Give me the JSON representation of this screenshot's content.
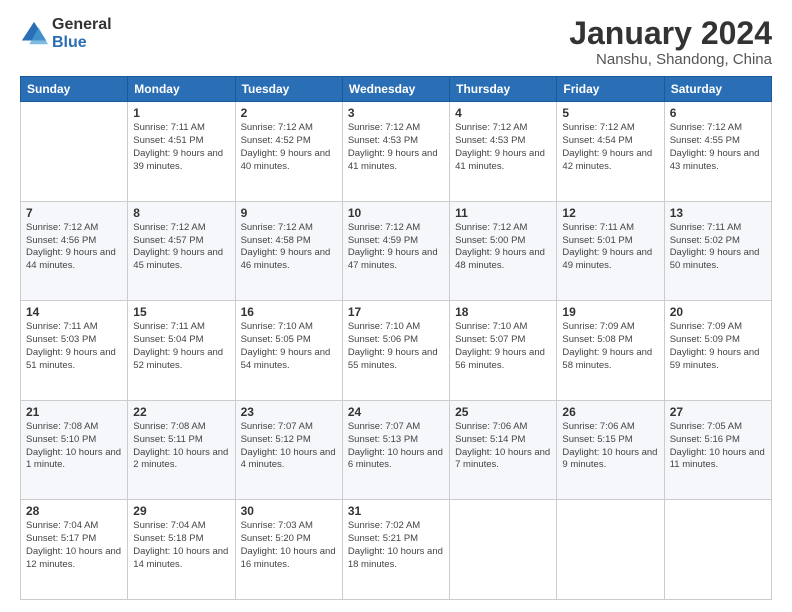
{
  "logo": {
    "general": "General",
    "blue": "Blue"
  },
  "title": "January 2024",
  "subtitle": "Nanshu, Shandong, China",
  "days_of_week": [
    "Sunday",
    "Monday",
    "Tuesday",
    "Wednesday",
    "Thursday",
    "Friday",
    "Saturday"
  ],
  "weeks": [
    [
      {
        "day": "",
        "sunrise": "",
        "sunset": "",
        "daylight": ""
      },
      {
        "day": "1",
        "sunrise": "Sunrise: 7:11 AM",
        "sunset": "Sunset: 4:51 PM",
        "daylight": "Daylight: 9 hours and 39 minutes."
      },
      {
        "day": "2",
        "sunrise": "Sunrise: 7:12 AM",
        "sunset": "Sunset: 4:52 PM",
        "daylight": "Daylight: 9 hours and 40 minutes."
      },
      {
        "day": "3",
        "sunrise": "Sunrise: 7:12 AM",
        "sunset": "Sunset: 4:53 PM",
        "daylight": "Daylight: 9 hours and 41 minutes."
      },
      {
        "day": "4",
        "sunrise": "Sunrise: 7:12 AM",
        "sunset": "Sunset: 4:53 PM",
        "daylight": "Daylight: 9 hours and 41 minutes."
      },
      {
        "day": "5",
        "sunrise": "Sunrise: 7:12 AM",
        "sunset": "Sunset: 4:54 PM",
        "daylight": "Daylight: 9 hours and 42 minutes."
      },
      {
        "day": "6",
        "sunrise": "Sunrise: 7:12 AM",
        "sunset": "Sunset: 4:55 PM",
        "daylight": "Daylight: 9 hours and 43 minutes."
      }
    ],
    [
      {
        "day": "7",
        "sunrise": "Sunrise: 7:12 AM",
        "sunset": "Sunset: 4:56 PM",
        "daylight": "Daylight: 9 hours and 44 minutes."
      },
      {
        "day": "8",
        "sunrise": "Sunrise: 7:12 AM",
        "sunset": "Sunset: 4:57 PM",
        "daylight": "Daylight: 9 hours and 45 minutes."
      },
      {
        "day": "9",
        "sunrise": "Sunrise: 7:12 AM",
        "sunset": "Sunset: 4:58 PM",
        "daylight": "Daylight: 9 hours and 46 minutes."
      },
      {
        "day": "10",
        "sunrise": "Sunrise: 7:12 AM",
        "sunset": "Sunset: 4:59 PM",
        "daylight": "Daylight: 9 hours and 47 minutes."
      },
      {
        "day": "11",
        "sunrise": "Sunrise: 7:12 AM",
        "sunset": "Sunset: 5:00 PM",
        "daylight": "Daylight: 9 hours and 48 minutes."
      },
      {
        "day": "12",
        "sunrise": "Sunrise: 7:11 AM",
        "sunset": "Sunset: 5:01 PM",
        "daylight": "Daylight: 9 hours and 49 minutes."
      },
      {
        "day": "13",
        "sunrise": "Sunrise: 7:11 AM",
        "sunset": "Sunset: 5:02 PM",
        "daylight": "Daylight: 9 hours and 50 minutes."
      }
    ],
    [
      {
        "day": "14",
        "sunrise": "Sunrise: 7:11 AM",
        "sunset": "Sunset: 5:03 PM",
        "daylight": "Daylight: 9 hours and 51 minutes."
      },
      {
        "day": "15",
        "sunrise": "Sunrise: 7:11 AM",
        "sunset": "Sunset: 5:04 PM",
        "daylight": "Daylight: 9 hours and 52 minutes."
      },
      {
        "day": "16",
        "sunrise": "Sunrise: 7:10 AM",
        "sunset": "Sunset: 5:05 PM",
        "daylight": "Daylight: 9 hours and 54 minutes."
      },
      {
        "day": "17",
        "sunrise": "Sunrise: 7:10 AM",
        "sunset": "Sunset: 5:06 PM",
        "daylight": "Daylight: 9 hours and 55 minutes."
      },
      {
        "day": "18",
        "sunrise": "Sunrise: 7:10 AM",
        "sunset": "Sunset: 5:07 PM",
        "daylight": "Daylight: 9 hours and 56 minutes."
      },
      {
        "day": "19",
        "sunrise": "Sunrise: 7:09 AM",
        "sunset": "Sunset: 5:08 PM",
        "daylight": "Daylight: 9 hours and 58 minutes."
      },
      {
        "day": "20",
        "sunrise": "Sunrise: 7:09 AM",
        "sunset": "Sunset: 5:09 PM",
        "daylight": "Daylight: 9 hours and 59 minutes."
      }
    ],
    [
      {
        "day": "21",
        "sunrise": "Sunrise: 7:08 AM",
        "sunset": "Sunset: 5:10 PM",
        "daylight": "Daylight: 10 hours and 1 minute."
      },
      {
        "day": "22",
        "sunrise": "Sunrise: 7:08 AM",
        "sunset": "Sunset: 5:11 PM",
        "daylight": "Daylight: 10 hours and 2 minutes."
      },
      {
        "day": "23",
        "sunrise": "Sunrise: 7:07 AM",
        "sunset": "Sunset: 5:12 PM",
        "daylight": "Daylight: 10 hours and 4 minutes."
      },
      {
        "day": "24",
        "sunrise": "Sunrise: 7:07 AM",
        "sunset": "Sunset: 5:13 PM",
        "daylight": "Daylight: 10 hours and 6 minutes."
      },
      {
        "day": "25",
        "sunrise": "Sunrise: 7:06 AM",
        "sunset": "Sunset: 5:14 PM",
        "daylight": "Daylight: 10 hours and 7 minutes."
      },
      {
        "day": "26",
        "sunrise": "Sunrise: 7:06 AM",
        "sunset": "Sunset: 5:15 PM",
        "daylight": "Daylight: 10 hours and 9 minutes."
      },
      {
        "day": "27",
        "sunrise": "Sunrise: 7:05 AM",
        "sunset": "Sunset: 5:16 PM",
        "daylight": "Daylight: 10 hours and 11 minutes."
      }
    ],
    [
      {
        "day": "28",
        "sunrise": "Sunrise: 7:04 AM",
        "sunset": "Sunset: 5:17 PM",
        "daylight": "Daylight: 10 hours and 12 minutes."
      },
      {
        "day": "29",
        "sunrise": "Sunrise: 7:04 AM",
        "sunset": "Sunset: 5:18 PM",
        "daylight": "Daylight: 10 hours and 14 minutes."
      },
      {
        "day": "30",
        "sunrise": "Sunrise: 7:03 AM",
        "sunset": "Sunset: 5:20 PM",
        "daylight": "Daylight: 10 hours and 16 minutes."
      },
      {
        "day": "31",
        "sunrise": "Sunrise: 7:02 AM",
        "sunset": "Sunset: 5:21 PM",
        "daylight": "Daylight: 10 hours and 18 minutes."
      },
      {
        "day": "",
        "sunrise": "",
        "sunset": "",
        "daylight": ""
      },
      {
        "day": "",
        "sunrise": "",
        "sunset": "",
        "daylight": ""
      },
      {
        "day": "",
        "sunrise": "",
        "sunset": "",
        "daylight": ""
      }
    ]
  ]
}
